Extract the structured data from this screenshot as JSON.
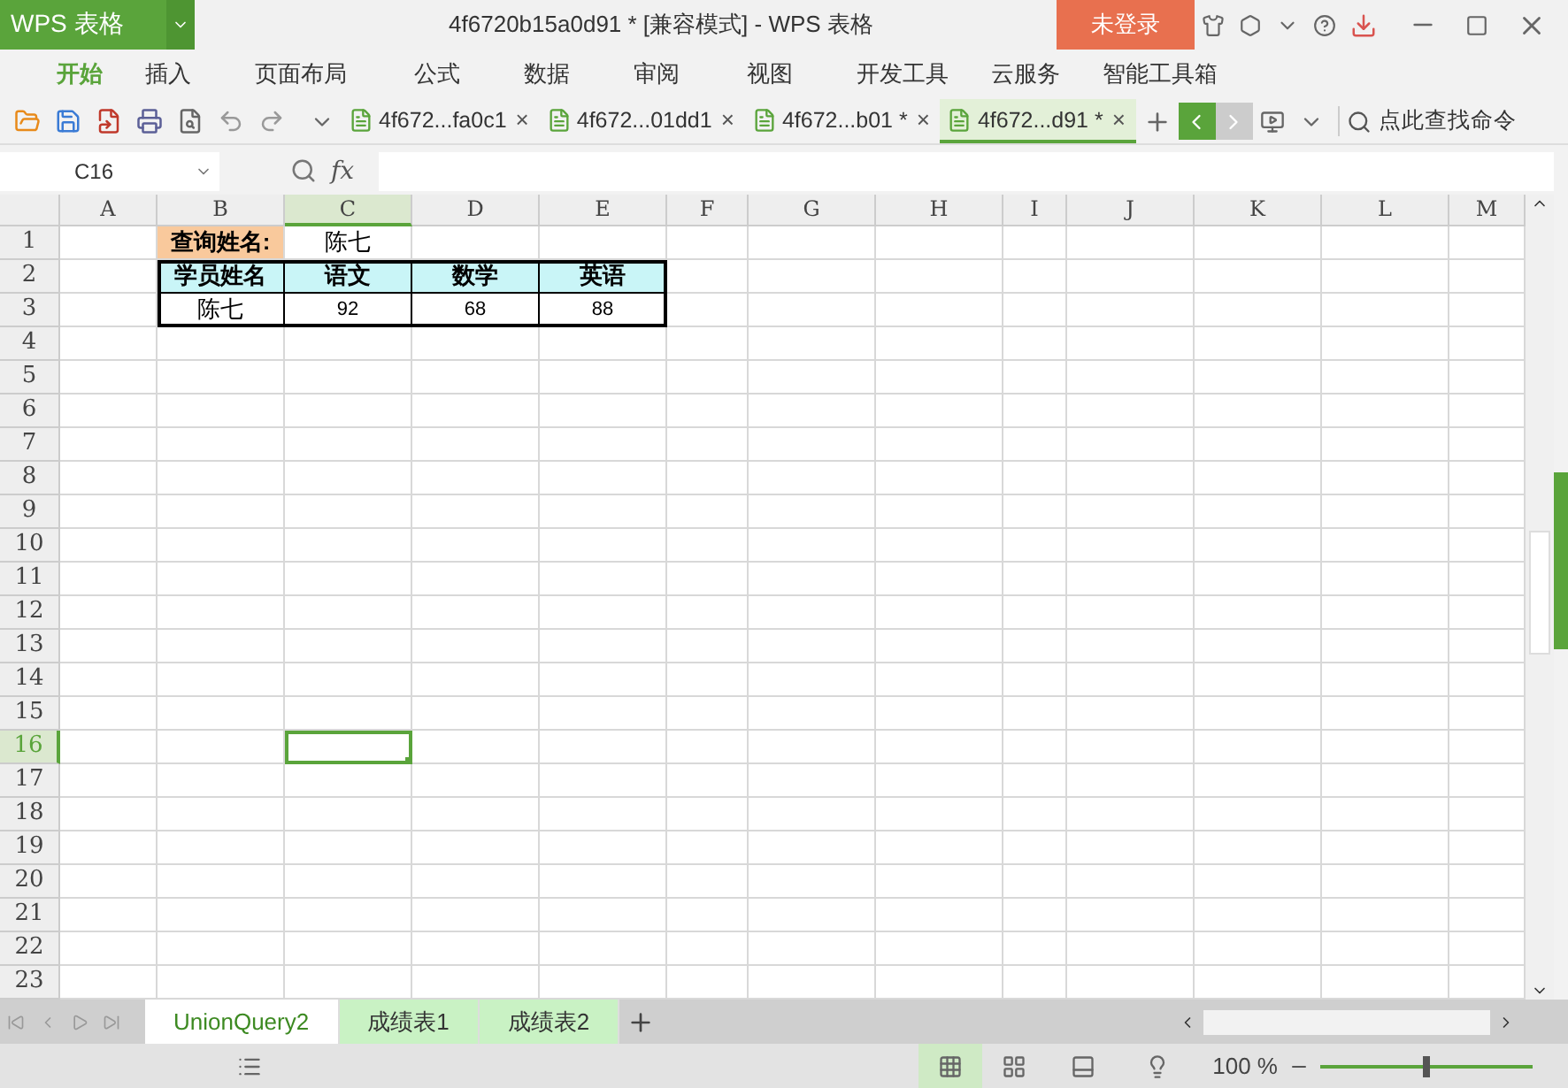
{
  "app": {
    "name": "WPS 表格"
  },
  "window": {
    "title": "4f6720b15a0d91 * [兼容模式] - WPS 表格",
    "login": "未登录"
  },
  "menu": [
    {
      "label": "开始",
      "selected": true
    },
    {
      "label": "插入",
      "selected": false
    },
    {
      "label": "页面布局",
      "selected": false
    },
    {
      "label": "公式",
      "selected": false
    },
    {
      "label": "数据",
      "selected": false
    },
    {
      "label": "审阅",
      "selected": false
    },
    {
      "label": "视图",
      "selected": false
    },
    {
      "label": "开发工具",
      "selected": false
    },
    {
      "label": "云服务",
      "selected": false
    },
    {
      "label": "智能工具箱",
      "selected": false
    }
  ],
  "documents": [
    {
      "label": "4f672...fa0c1",
      "close": "×",
      "selected": false
    },
    {
      "label": "4f672...01dd1",
      "close": "×",
      "selected": false
    },
    {
      "label": "4f672...b01 *",
      "close": "×",
      "selected": false
    },
    {
      "label": "4f672...d91 *",
      "close": "×",
      "selected": true
    }
  ],
  "search": {
    "placeholder": "点此查找命令"
  },
  "formula_bar": {
    "cell": "C16",
    "fx": "fx"
  },
  "sheet": {
    "columns": [
      {
        "label": "A",
        "selected": false
      },
      {
        "label": "B",
        "selected": false
      },
      {
        "label": "C",
        "selected": true
      },
      {
        "label": "D",
        "selected": false
      },
      {
        "label": "E",
        "selected": false
      },
      {
        "label": "F",
        "selected": false
      },
      {
        "label": "G",
        "selected": false
      },
      {
        "label": "H",
        "selected": false
      },
      {
        "label": "I",
        "selected": false
      },
      {
        "label": "J",
        "selected": false
      },
      {
        "label": "K",
        "selected": false
      },
      {
        "label": "L",
        "selected": false
      },
      {
        "label": "M",
        "selected": false
      }
    ],
    "rows": [
      {
        "label": "1",
        "selected": false
      },
      {
        "label": "2",
        "selected": false
      },
      {
        "label": "3",
        "selected": false
      },
      {
        "label": "4",
        "selected": false
      },
      {
        "label": "5",
        "selected": false
      },
      {
        "label": "6",
        "selected": false
      },
      {
        "label": "7",
        "selected": false
      },
      {
        "label": "8",
        "selected": false
      },
      {
        "label": "9",
        "selected": false
      },
      {
        "label": "10",
        "selected": false
      },
      {
        "label": "11",
        "selected": false
      },
      {
        "label": "12",
        "selected": false
      },
      {
        "label": "13",
        "selected": false
      },
      {
        "label": "14",
        "selected": false
      },
      {
        "label": "15",
        "selected": false
      },
      {
        "label": "16",
        "selected": true
      },
      {
        "label": "17",
        "selected": false
      },
      {
        "label": "18",
        "selected": false
      },
      {
        "label": "19",
        "selected": false
      },
      {
        "label": "20",
        "selected": false
      },
      {
        "label": "21",
        "selected": false
      },
      {
        "label": "22",
        "selected": false
      },
      {
        "label": "23",
        "selected": false
      }
    ],
    "lookup": {
      "label": "查询姓名:",
      "value": "陈七"
    },
    "table": {
      "columns": [
        "学员姓名",
        "语文",
        "数学",
        "英语"
      ],
      "rows": [
        [
          "陈七",
          "92",
          "68",
          "88"
        ]
      ]
    }
  },
  "sheet_tabs": [
    {
      "label": "UnionQuery2",
      "selected": true
    },
    {
      "label": "成绩表1",
      "selected": false
    },
    {
      "label": "成绩表2",
      "selected": false
    }
  ],
  "status_bar": {
    "zoom": "100 %",
    "zoom_slider": {
      "level": 0.5
    }
  }
}
